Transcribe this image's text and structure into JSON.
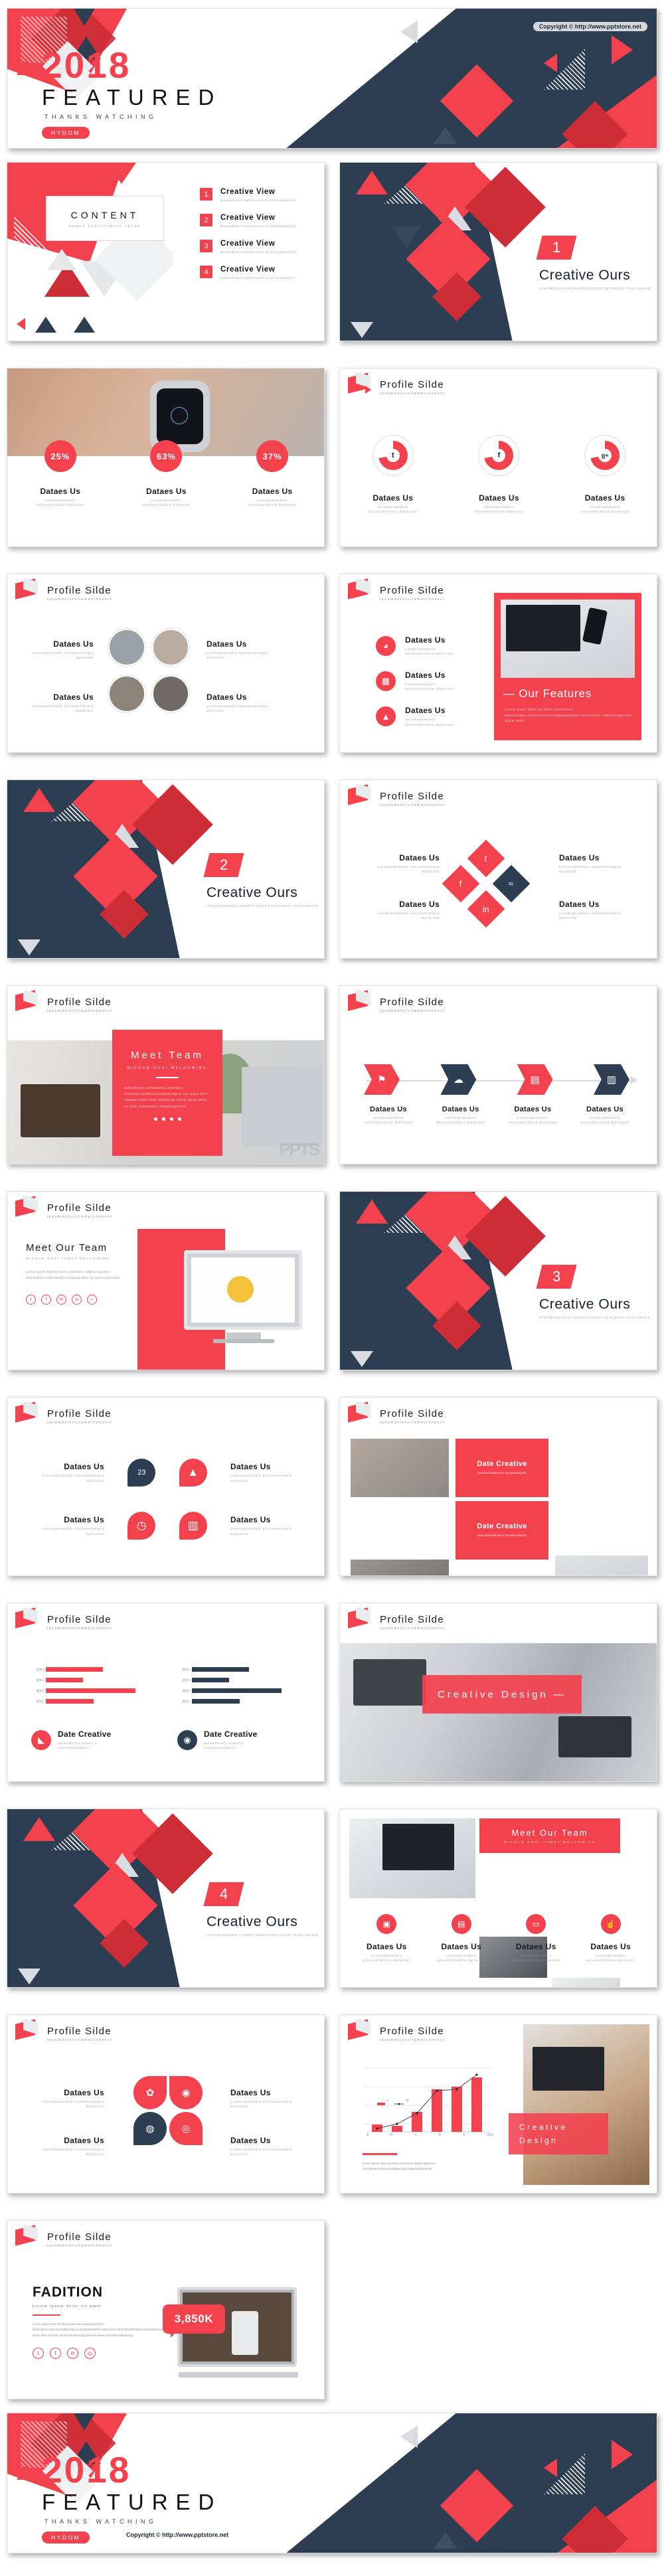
{
  "copyright": "Copyright © http://www.pptstore.net",
  "hero": {
    "year": "2018",
    "title": "FEATURED",
    "subtitle": "THANKS WATCHING",
    "badge": "HYDOM"
  },
  "profile_header": {
    "title": "Profile Silde",
    "subtitle": "ipsumdolorsitametconsect"
  },
  "common": {
    "dataes": "Dataes Us",
    "dataes_sub": "Loremipsumdolo sitconsectetura dipiscosz",
    "date_creative": "Date  Creative",
    "date_creative_sub": "ipsumdolorsitametco nsecteturadipisci"
  },
  "slides": [
    {
      "id": "content",
      "kind": "content-list",
      "panel_title": "CONTENT",
      "panel_sub": "SUMDO LORSITAMETC TETUR",
      "items": [
        {
          "n": "1",
          "label": "Creative  View",
          "sub": "ipsumdolorsitametcons ecteturadipiscin"
        },
        {
          "n": "2",
          "label": "Creative  View",
          "sub": "ipsumdolorsitametcons ecteturadipiscin"
        },
        {
          "n": "3",
          "label": "Creative  View",
          "sub": "ipsumdolorsitametcons ecteturadipiscin"
        },
        {
          "n": "4",
          "label": "Creative  View",
          "sub": "ipsumdolorsitametcons ecteturadipiscin"
        }
      ]
    },
    {
      "id": "section-1",
      "kind": "section",
      "number": "1",
      "title": "Creative Ours",
      "sub": "IPSUMDOLORSITAMETCONSECTETURADI PISCINGOO"
    },
    {
      "id": "stats-percent",
      "kind": "stats",
      "stats": [
        {
          "pct": "25%",
          "title": "Dataes Us",
          "sub": "Loremipsumdolo sitconsectetura dipiscosz"
        },
        {
          "pct": "63%",
          "title": "Dataes Us",
          "sub": "Loremipsumdolo sitconsectetura dipiscosz"
        },
        {
          "pct": "37%",
          "title": "Dataes Us",
          "sub": "Loremipsumdolo sitconsectetura dipiscosz"
        }
      ]
    },
    {
      "id": "social-donuts",
      "kind": "donuts",
      "donuts": [
        {
          "icon": "twitter-icon",
          "glyph": "t",
          "title": "Dataes Us",
          "sub": "Loremipsumdolo sitconsectetura dipiscosz"
        },
        {
          "icon": "facebook-icon",
          "glyph": "f",
          "title": "Dataes Us",
          "sub": "Loremipsumdolo sitconsectetura dipiscosz"
        },
        {
          "icon": "googleplus-icon",
          "glyph": "g+",
          "title": "Dataes Us",
          "sub": "Loremipsumdolo sitconsectetura dipiscosz"
        }
      ]
    },
    {
      "id": "team-photos",
      "kind": "team-circles",
      "left": [
        {
          "title": "Dataes Us",
          "sub": "Loremipsumdolo sitconsectetura dipiscosz"
        },
        {
          "title": "Dataes Us",
          "sub": "Loremipsumdolo sitconsectetura dipiscosz"
        }
      ],
      "right": [
        {
          "title": "Dataes Us",
          "sub": "Loremipsumdolo sitconsectetura dipiscosz"
        },
        {
          "title": "Dataes Us",
          "sub": "Loremipsumdolo sitconsectetura dipiscosz"
        }
      ]
    },
    {
      "id": "our-features",
      "kind": "features",
      "features": [
        {
          "icon": "rocket-icon",
          "glyph": "◕",
          "title": "Dataes Us",
          "sub": "Loremipsumdolo sitconsectetura dipiscosz"
        },
        {
          "icon": "calculator-icon",
          "glyph": "▦",
          "title": "Dataes Us",
          "sub": "Loremipsumdolo sitconsectetura dipiscosz"
        },
        {
          "icon": "graduation-icon",
          "glyph": "▲",
          "title": "Dataes Us",
          "sub": "Loremipsumdolo sitconsectetura dipiscosz"
        }
      ],
      "panel_title": "— Our Features",
      "panel_body": "Lorem ipsum dolor sit amet,consectetur dolorsitamet,consecteturLoremipsumsitamet,consectetur adipiscingLorem ipsum dolor"
    },
    {
      "id": "section-2",
      "kind": "section",
      "number": "2",
      "title": "Creative Ours",
      "sub": "IPSUMDOLORSITAMETCONSECTETURADI PISCINGOO"
    },
    {
      "id": "diamond-social",
      "kind": "diamond",
      "labels": [
        {
          "title": "Dataes Us",
          "sub": "Loremipsumdolo sitconsectetura dipiscosz"
        },
        {
          "title": "Dataes Us",
          "sub": "Loremipsumdolo sitconsectetura dipiscosz"
        },
        {
          "title": "Dataes Us",
          "sub": "Loremipsumdolo sitconsectetura dipiscosz"
        },
        {
          "title": "Dataes Us",
          "sub": "Loremipsumdolo sitconsectetura dipiscosz"
        }
      ],
      "icons": [
        "twitter-icon",
        "facebook-icon",
        "rss-icon",
        "linkedin-icon"
      ]
    },
    {
      "id": "meet-team",
      "kind": "meet-team",
      "title": "Meet  Team",
      "sub": "MIPSUM DOSI WELCOMING",
      "body": "dolorsitamet,consecteturLoremipsu msitamet,consecteturadipiscingLor em ipsum dolo sitamet,consectetur adipiscing Lorem ipsum dolor sit amet,consectetur adipiscingLorem",
      "dots": 4
    },
    {
      "id": "process-arrow",
      "kind": "process",
      "steps": [
        {
          "icon": "flag-icon",
          "glyph": "⚑",
          "title": "Dataes Us"
        },
        {
          "icon": "cloud-icon",
          "glyph": "☁",
          "title": "Dataes Us"
        },
        {
          "icon": "doc-icon",
          "glyph": "▤",
          "title": "Dataes Us"
        },
        {
          "icon": "chart-icon",
          "glyph": "▥",
          "title": "Dataes Us"
        }
      ]
    },
    {
      "id": "meet-our-team-mac",
      "kind": "meet-team-mac",
      "title": "Meet Our Team",
      "sub": "MIPSUM DOSI TAMET WELCOMING",
      "body": "Lorem ipsum dolor sit amet,consectetur adipiscingLorem dolorsitamet,consecteturLoremipsum dolor sit amet,consectetur",
      "socials": [
        "twitter-icon",
        "facebook-icon",
        "linkedin-icon",
        "instagram-icon",
        "rss-icon"
      ]
    },
    {
      "id": "section-3",
      "kind": "section",
      "number": "3",
      "title": "Creative Ours",
      "sub": "IPSUMDOLORSITAMETCONSECTETURADI PISCINGOO"
    },
    {
      "id": "icon-grid-4",
      "kind": "icon-grid",
      "cells": [
        {
          "icon": "calendar-icon",
          "glyph": "23",
          "title": "Dataes Us",
          "sub": "Loremipsumdolo sitconsectetura dipiscosz",
          "side": "left",
          "color": "#2d3e52"
        },
        {
          "icon": "android-icon",
          "glyph": "▲",
          "title": "Dataes Us",
          "sub": "Loremipsumdolo sitconsectetura dipiscosz",
          "side": "right",
          "color": "#f4414e"
        },
        {
          "icon": "alarm-icon",
          "glyph": "◷",
          "title": "Dataes Us",
          "sub": "Loremipsumdolo sitconsectetura dipiscosz",
          "side": "left",
          "color": "#f4414e"
        },
        {
          "icon": "bars-icon",
          "glyph": "▥",
          "title": "Dataes Us",
          "sub": "Loremipsumdolo sitconsectetura dipiscosz",
          "side": "right",
          "color": "#f4414e"
        }
      ]
    },
    {
      "id": "photo-cards",
      "kind": "photo-cards",
      "cards": [
        {
          "title": "Date  Creative",
          "sub": "ipsumdolorsitametco nsecteturadipisci"
        },
        {
          "title": "Date  Creative",
          "sub": "ipsumdolorsitametco nsecteturadipisci"
        }
      ]
    },
    {
      "id": "bar-charts",
      "kind": "bar-charts",
      "charts": [
        {
          "color": "#f4414e",
          "title": "Date  Creative",
          "sub": "ipsumdolorsitametco nsecteturadipisci",
          "icon": "megaphone-icon",
          "glyph": "◣"
        },
        {
          "color": "#2d3e52",
          "title": "Date  Creative",
          "sub": "ipsumdolorsitametco nsecteturadipisci",
          "icon": "camera-icon",
          "glyph": "◉"
        }
      ]
    },
    {
      "id": "creative-design-banner",
      "kind": "design-banner",
      "title": "Creative Design —"
    },
    {
      "id": "section-4",
      "kind": "section",
      "number": "4",
      "title": "Creative Ours",
      "sub": "IPSUMDOLORSITAMETCONSECTETURADI PISCINGOO"
    },
    {
      "id": "meet-our-team-icons",
      "kind": "team-icons",
      "banner_title": "Meet Our Team",
      "banner_sub": "MIPSUM DOSI TAMET,WELCOMING",
      "items": [
        {
          "icon": "image-icon",
          "glyph": "▣",
          "title": "Dataes Us",
          "sub": "Loremipsumdolo sitconsectetura dipiscosz"
        },
        {
          "icon": "gallery-icon",
          "glyph": "▤",
          "title": "Dataes Us",
          "sub": "Loremipsumdolo sitconsectetura dipiscosz"
        },
        {
          "icon": "monitor-icon",
          "glyph": "▭",
          "title": "Dataes Us",
          "sub": "Loremipsumdolo sitconsectetura dipiscosz"
        },
        {
          "icon": "thumbsup-icon",
          "glyph": "☝",
          "title": "Dataes Us",
          "sub": "Loremipsumdolo sitconsectetura dipiscosz"
        }
      ]
    },
    {
      "id": "petal-icons",
      "kind": "petals",
      "labels": [
        {
          "title": "Dataes Us",
          "sub": "Loremipsumdolo sitconsectetura dipiscosz"
        },
        {
          "title": "Dataes Us",
          "sub": "Loremipsumdolo sitconsectetura dipiscosz"
        },
        {
          "title": "Dataes Us",
          "sub": "Loremipsumdolo sitconsectetura dipiscosz"
        },
        {
          "title": "Dataes Us",
          "sub": "Loremipsumdolo sitconsectetura dipiscosz"
        }
      ],
      "icons": [
        "gear-icon",
        "camera-icon",
        "bulb-icon",
        "target-icon"
      ]
    },
    {
      "id": "combo-chart-design",
      "kind": "combo-chart",
      "panel_title": "Creative Design",
      "caption": "Lorem ipsum dolor sit amet,consectetur adipiscingLorem dolorsiameconsecteturadipiscingLoreipsudolorsitamet"
    },
    {
      "id": "fadition",
      "kind": "fadition",
      "title": "FADITION",
      "sub": "Lorem  ipsum  dolor  sit  amet",
      "body": "Lorem ipsum dolor sit amet,consectetur adipiscingLorem dolorsiameconsecteturadipiscingLoreipsudolorsitamet,consectetur,Loremipsumsitamet,consecteturLorem ipsum dolor sit amet,consecteturdipiscingLoredolorsiameconsecteturadipiscingL.",
      "badge": "3,850K",
      "socials": [
        "twitter-icon",
        "facebook-icon",
        "linkedin-icon",
        "instagram-icon"
      ]
    }
  ],
  "chart_data": [
    {
      "type": "bar",
      "orientation": "horizontal",
      "title": "Date  Creative",
      "categories": [
        "类别1",
        "类别2",
        "类别3",
        "类别4"
      ],
      "values": [
        4.3,
        8.2,
        3.5,
        5.5
      ],
      "color": "#f4414e",
      "xlabel": "",
      "ylabel": "",
      "xlim": [
        0,
        9
      ],
      "grid": false
    },
    {
      "type": "bar",
      "orientation": "horizontal",
      "title": "Date  Creative",
      "categories": [
        "类别1",
        "类别2",
        "类别3",
        "类别4"
      ],
      "values": [
        4.3,
        8.2,
        3.5,
        5.5
      ],
      "color": "#2d3e52",
      "xlabel": "",
      "ylabel": "",
      "xlim": [
        0,
        9
      ],
      "grid": false
    },
    {
      "type": "bar",
      "title": "",
      "categories": [
        "A",
        "B",
        "C",
        "D",
        "E",
        "DEC"
      ],
      "series": [
        {
          "name": "A:",
          "type": "bar",
          "values": [
            8,
            7,
            22,
            48,
            52,
            68
          ],
          "color": "#f4414e"
        },
        {
          "name": "B:",
          "type": "line",
          "values": [
            4,
            10,
            24,
            52,
            55,
            78
          ],
          "color": "#3a3a3a"
        }
      ],
      "ylim": [
        0,
        90
      ],
      "grid": true,
      "legend": [
        "A:",
        "B:"
      ],
      "legend_position": "left"
    }
  ]
}
